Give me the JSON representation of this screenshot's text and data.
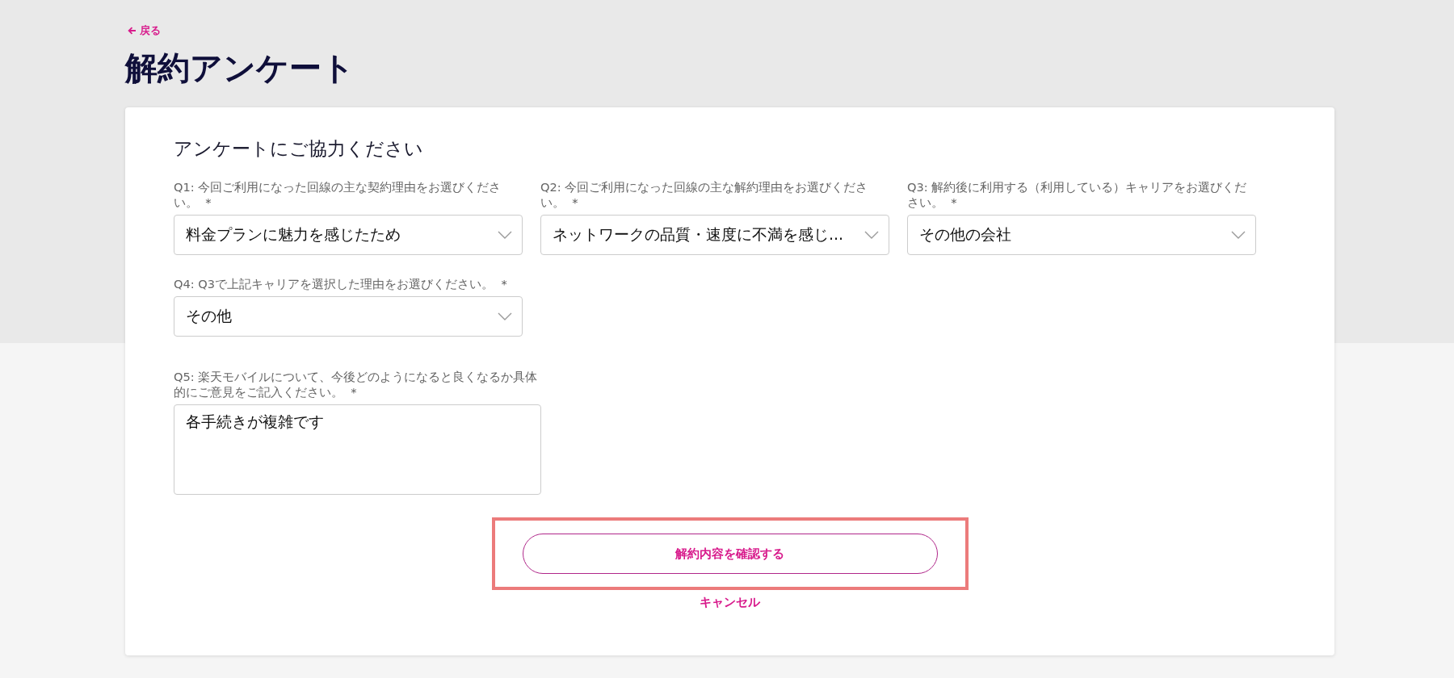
{
  "back_link": "戻る",
  "page_title": "解約アンケート",
  "card_title": "アンケートにご協力ください",
  "questions": [
    {
      "kind": "select",
      "label": "Q1: 今回ご利用になった回線の主な契約理由をお選びください。",
      "marker": "*",
      "value": "料金プランに魅力を感じたため"
    },
    {
      "kind": "select",
      "label": "Q2: 今回ご利用になった回線の主な解約理由をお選びください。",
      "marker": "*",
      "value": "ネットワークの品質・速度に不満を感じ..."
    },
    {
      "kind": "select",
      "label": "Q3: 解約後に利用する（利用している）キャリアをお選びください。",
      "marker": "*",
      "value": "その他の会社"
    },
    {
      "kind": "select",
      "label": "Q4: Q3で上記キャリアを選択した理由をお選びください。",
      "marker": "*",
      "value": "その他"
    },
    {
      "kind": "textarea",
      "label": "Q5: 楽天モバイルについて、今後どのようになると良くなるか具体的にご意見をご記入ください。",
      "marker": "*",
      "value": "各手続きが複雑です"
    }
  ],
  "confirm_button": {
    "label": "解約内容を確認する",
    "highlighted": true
  },
  "cancel_link": "キャンセル"
}
